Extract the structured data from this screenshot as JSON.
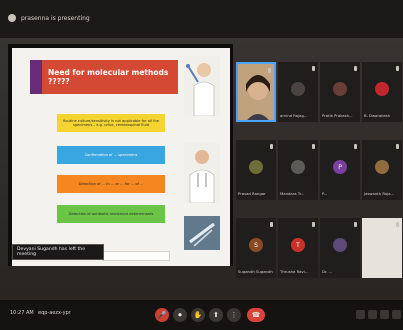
{
  "topbar": {
    "presenter_label": "prasenna is presenting"
  },
  "slide": {
    "title": "Need for molecular methods ?????",
    "bullets": [
      "Routine culture/sensitivity is not applicable for all the specimens – e.g. urine, cerebrospinal fluid",
      "Confirmation of ... specimens",
      "Detection of ... in ... or ... for ... of ...",
      "Detection of antibiotic resistance determinants"
    ]
  },
  "toast": {
    "text": "Devyani Sugandh has left the meeting"
  },
  "participants": [
    {
      "initial": "",
      "name": ""
    },
    {
      "initial": "",
      "name": "arvind Rajag..."
    },
    {
      "initial": "",
      "name": "Pratik Prakash..."
    },
    {
      "initial": "",
      "name": "B. Dwarakesh"
    },
    {
      "initial": "",
      "name": "Prasad Rangar"
    },
    {
      "initial": "",
      "name": "Mandara Tr..."
    },
    {
      "initial": "P",
      "name": "P..."
    },
    {
      "initial": "",
      "name": "Jaswanth Raja..."
    },
    {
      "initial": "S",
      "name": "Sugandh Sugandh"
    },
    {
      "initial": "T",
      "name": "Thrusha Ravi..."
    },
    {
      "initial": "",
      "name": "Dr. ..."
    },
    {
      "initial": "",
      "name": ""
    }
  ],
  "controls": {
    "time": "10:27 AM",
    "meeting_code": "eqp-aezx-ypr",
    "buttons": [
      "mic",
      "camera",
      "raise-hand",
      "present",
      "more",
      "end-call"
    ]
  },
  "colors": {
    "accent": "#d44934",
    "end": "#d8433a",
    "tile_bg": "#201e1d"
  }
}
